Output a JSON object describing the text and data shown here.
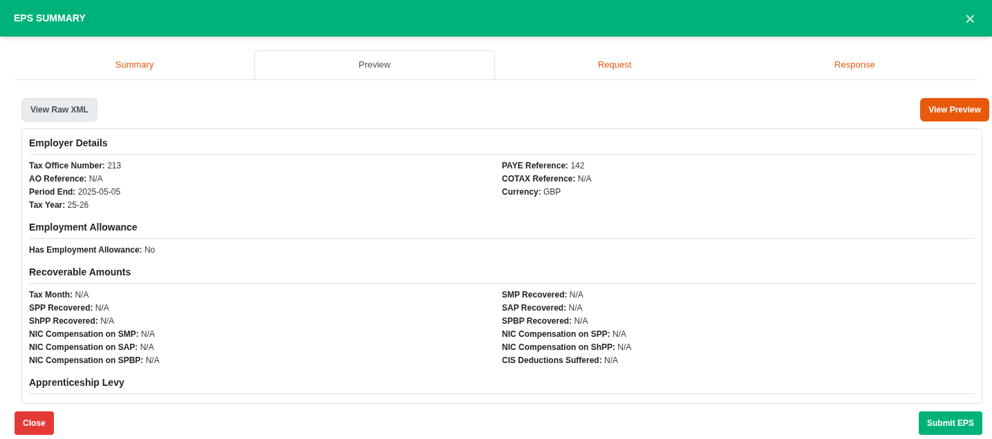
{
  "dialog": {
    "title": "EPS SUMMARY",
    "close_icon": "×"
  },
  "tabs": [
    {
      "label": "Summary",
      "selected": false
    },
    {
      "label": "Preview",
      "selected": true
    },
    {
      "label": "Request",
      "selected": false
    },
    {
      "label": "Response",
      "selected": false
    }
  ],
  "toolbar": {
    "raw_button": "View Raw XML",
    "preview_button": "View Preview"
  },
  "sections": [
    {
      "heading": "Employer Details",
      "left": [
        {
          "label": "Tax Office Number:",
          "value": "213"
        },
        {
          "label": "AO Reference:",
          "value": "N/A"
        },
        {
          "label": "Period End:",
          "value": "2025-05-05"
        },
        {
          "label": "Tax Year:",
          "value": "25-26"
        }
      ],
      "right": [
        {
          "label": "PAYE Reference:",
          "value": "142"
        },
        {
          "label": "COTAX Reference:",
          "value": "N/A"
        },
        {
          "label": "Currency:",
          "value": "GBP"
        }
      ]
    },
    {
      "heading": "Employment Allowance",
      "left": [
        {
          "label": "Has Employment Allowance:",
          "value": "No"
        }
      ]
    },
    {
      "heading": "Recoverable Amounts",
      "left": [
        {
          "label": "Tax Month:",
          "value": "N/A"
        },
        {
          "label": "SPP Recovered:",
          "value": "N/A"
        },
        {
          "label": "ShPP Recovered:",
          "value": "N/A"
        },
        {
          "label": "NIC Compensation on SMP:",
          "value": "N/A"
        },
        {
          "label": "NIC Compensation on SAP:",
          "value": "N/A"
        },
        {
          "label": "NIC Compensation on SPBP:",
          "value": "N/A"
        }
      ],
      "right": [
        {
          "label": "SMP Recovered:",
          "value": "N/A"
        },
        {
          "label": "SAP Recovered:",
          "value": "N/A"
        },
        {
          "label": "SPBP Recovered:",
          "value": "N/A"
        },
        {
          "label": "NIC Compensation on SPP:",
          "value": "N/A"
        },
        {
          "label": "NIC Compensation on ShPP:",
          "value": "N/A"
        },
        {
          "label": "CIS Deductions Suffered:",
          "value": "N/A"
        }
      ]
    },
    {
      "heading": "Apprenticeship Levy"
    }
  ],
  "footer": {
    "close_button": "Close",
    "submit_button": "Submit EPS"
  }
}
